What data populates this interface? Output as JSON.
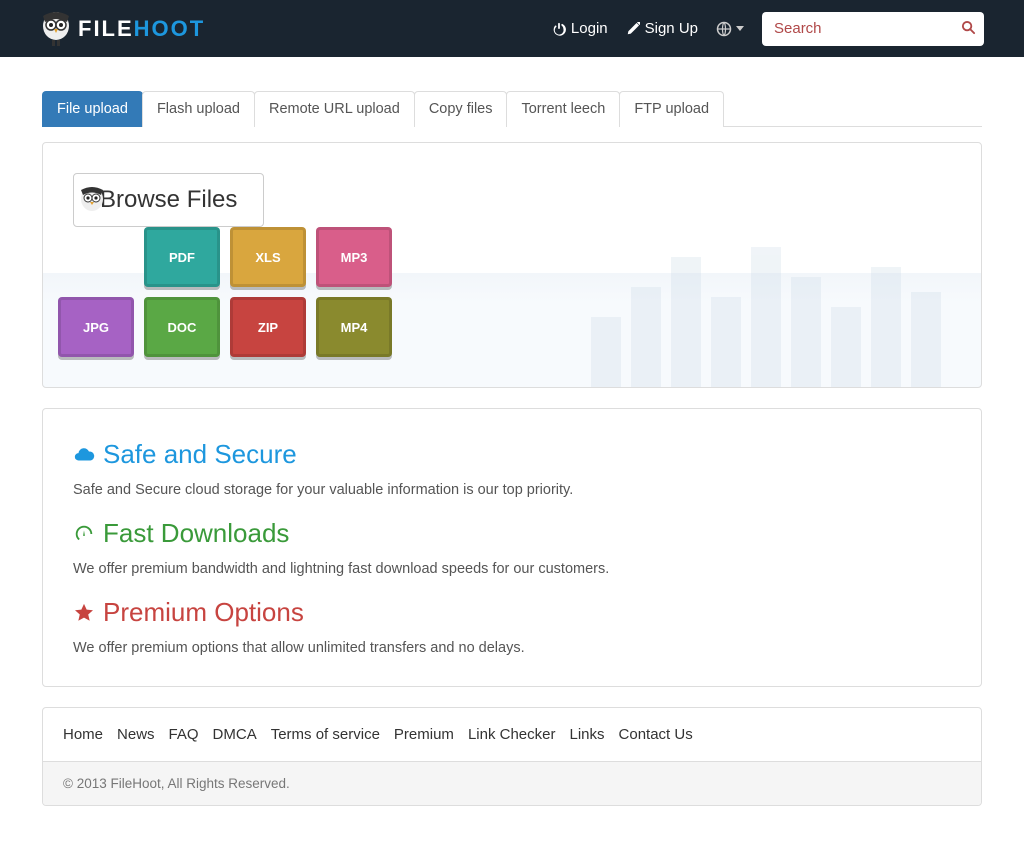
{
  "brand": {
    "part1": "FILE",
    "part2": "HOOT"
  },
  "nav": {
    "login": "Login",
    "signup": "Sign Up",
    "search_placeholder": "Search"
  },
  "tabs": [
    {
      "label": "File upload",
      "active": true
    },
    {
      "label": "Flash upload",
      "active": false
    },
    {
      "label": "Remote URL upload",
      "active": false
    },
    {
      "label": "Copy files",
      "active": false
    },
    {
      "label": "Torrent leech",
      "active": false
    },
    {
      "label": "FTP upload",
      "active": false
    }
  ],
  "browse_label": "Browse Files",
  "crates": {
    "pdf": "PDF",
    "xls": "XLS",
    "mp3": "MP3",
    "jpg": "JPG",
    "doc": "DOC",
    "zip": "ZIP",
    "mp4": "MP4"
  },
  "features": {
    "safe": {
      "title": "Safe and Secure",
      "body": "Safe and Secure cloud storage for your valuable information is our top priority."
    },
    "fast": {
      "title": "Fast Downloads",
      "body": "We offer premium bandwidth and lightning fast download speeds for our customers."
    },
    "premium": {
      "title": "Premium Options",
      "body": "We offer premium options that allow unlimited transfers and no delays."
    }
  },
  "footer": {
    "links": [
      "Home",
      "News",
      "FAQ",
      "DMCA",
      "Terms of service",
      "Premium",
      "Link Checker",
      "Links",
      "Contact Us"
    ],
    "copyright": "© 2013 FileHoot, All Rights Reserved."
  }
}
